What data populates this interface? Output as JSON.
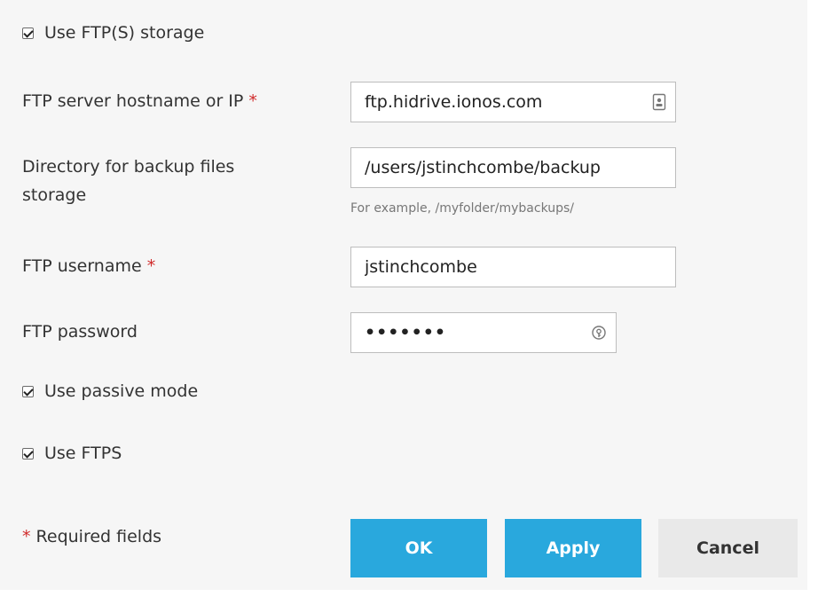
{
  "storage": {
    "use_ftp_label": "Use FTP(S) storage"
  },
  "fields": {
    "hostname": {
      "label": "FTP server hostname or IP",
      "required_mark": "*",
      "value": "ftp.hidrive.ionos.com"
    },
    "directory": {
      "label_line1": "Directory for backup files",
      "label_line2": "storage",
      "value": "/users/jstinchcombe/backup",
      "hint": "For example, /myfolder/mybackups/"
    },
    "username": {
      "label": "FTP username",
      "required_mark": "*",
      "value": "jstinchcombe"
    },
    "password": {
      "label": "FTP password",
      "value": "•••••••"
    }
  },
  "options": {
    "passive_mode_label": "Use passive mode",
    "ftps_label": "Use FTPS"
  },
  "footer": {
    "required_mark": "*",
    "required_text": "Required fields",
    "ok_label": "OK",
    "apply_label": "Apply",
    "cancel_label": "Cancel"
  },
  "colors": {
    "primary": "#29a8dd",
    "required": "#d02a2a",
    "panel_bg": "#f6f6f6"
  }
}
